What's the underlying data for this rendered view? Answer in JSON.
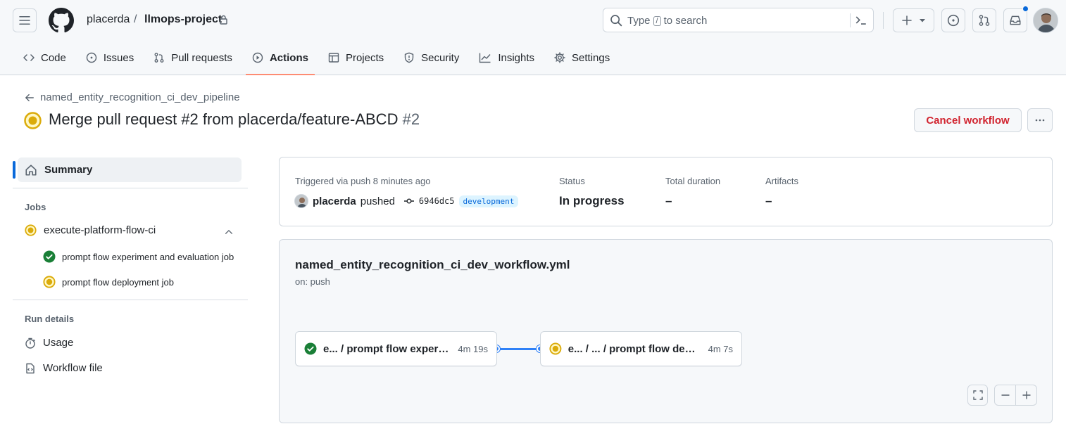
{
  "header": {
    "owner": "placerda",
    "separator": "/",
    "repo": "llmops-project",
    "search": {
      "prefix": "Type",
      "key": "/",
      "suffix": "to search"
    }
  },
  "repo_nav": {
    "tabs": [
      {
        "label": "Code",
        "icon": "code-icon",
        "active": false
      },
      {
        "label": "Issues",
        "icon": "issue-opened-icon",
        "active": false
      },
      {
        "label": "Pull requests",
        "icon": "git-pull-request-icon",
        "active": false
      },
      {
        "label": "Actions",
        "icon": "play-icon",
        "active": true
      },
      {
        "label": "Projects",
        "icon": "table-icon",
        "active": false
      },
      {
        "label": "Security",
        "icon": "shield-icon",
        "active": false
      },
      {
        "label": "Insights",
        "icon": "graph-icon",
        "active": false
      },
      {
        "label": "Settings",
        "icon": "gear-icon",
        "active": false
      }
    ]
  },
  "run": {
    "back_label": "named_entity_recognition_ci_dev_pipeline",
    "title": "Merge pull request #2 from placerda/feature-ABCD",
    "number": "#2",
    "cancel_label": "Cancel workflow"
  },
  "sidebar": {
    "summary_label": "Summary",
    "jobs_heading": "Jobs",
    "job": {
      "label": "execute-platform-flow-ci",
      "steps": [
        {
          "label": "prompt flow experiment and evaluation job",
          "status": "success"
        },
        {
          "label": "prompt flow deployment job",
          "status": "in_progress"
        }
      ]
    },
    "run_details_heading": "Run details",
    "links": [
      {
        "label": "Usage",
        "icon": "stopwatch-icon"
      },
      {
        "label": "Workflow file",
        "icon": "file-code-icon"
      }
    ]
  },
  "summary": {
    "trigger_label": "Triggered via push 8 minutes ago",
    "actor": "placerda",
    "action": "pushed",
    "commit": "6946dc5",
    "branch": "development",
    "status_label": "Status",
    "status_value": "In progress",
    "duration_label": "Total duration",
    "duration_value": "–",
    "artifacts_label": "Artifacts",
    "artifacts_value": "–"
  },
  "graph": {
    "file": "named_entity_recognition_ci_dev_workflow.yml",
    "on": "on: push",
    "nodes": [
      {
        "name": "e... / prompt flow experiment and evaluation job",
        "time": "4m 19s",
        "status": "success"
      },
      {
        "name": "e... / ... / prompt flow deployment job",
        "time": "4m 7s",
        "status": "in_progress"
      }
    ]
  },
  "colors": {
    "accent_blue": "#0969da",
    "success_green": "#1a7f37",
    "in_progress_yellow": "#dbab0a",
    "danger_red": "#d1242f",
    "tab_underline": "#fd8c73"
  }
}
